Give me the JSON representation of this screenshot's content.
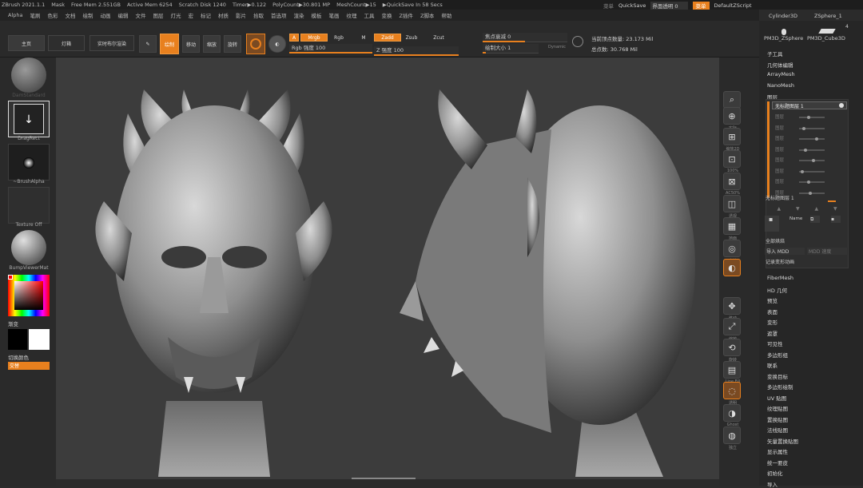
{
  "titlebar": {
    "app": "ZBrush 2021.1.1",
    "mask": "Mask",
    "free_mem": "Free Mem 2.551GB",
    "active_mem": "Active Mem 6254",
    "scratch_disk": "Scratch Disk 1240",
    "timer": "Timer▶0.122",
    "poly_count": "PolyCount▶30.801 MP",
    "mesh_count": "MeshCount▶15",
    "quicksave": "▶QuickSave In 58 Secs"
  },
  "topright": {
    "menu": "菜单",
    "quicksave_btn": "QuickSave",
    "transparency": "界面透明 0",
    "accent": "菜单",
    "script": "DefaultZScript"
  },
  "menubar": [
    "Alpha",
    "笔刷",
    "色彩",
    "文档",
    "绘制",
    "动画",
    "编辑",
    "文件",
    "图层",
    "灯光",
    "宏",
    "标记",
    "材质",
    "影片",
    "拾取",
    "首选项",
    "渲染",
    "模板",
    "笔画",
    "纹理",
    "工具",
    "变换",
    "Z插件",
    "Z脚本",
    "帮助"
  ],
  "toolbar": {
    "home": "主页",
    "lightbox": "灯箱",
    "live_boolean": "实时布尔渲染",
    "edit": "编辑",
    "draw": "绘制",
    "move": "移动",
    "scale": "缩放",
    "rotate": "旋转",
    "a": "A",
    "mrgb": "Mrgb",
    "rgb": "Rgb",
    "m": "M",
    "zadd": "Zadd",
    "zsub": "Zsub",
    "zcut": "Zcut",
    "rgb_intensity": "Rgb 强度 100",
    "z_intensity": "Z 强度 100",
    "focal_shift": "焦点衰减 0",
    "draw_size": "绘制大小 1",
    "dynamic": "Dynamic",
    "active_points": "当前顶点数量: 23.173 Mil",
    "total_points": "总点数: 30.768 Mil"
  },
  "leftshelf": {
    "brush": "DamStandard",
    "stroke": "DragRect",
    "alpha": "~BrushAlpha",
    "texture": "Texture Off",
    "material": "BumpViewerMat",
    "gradient": "渐变",
    "switch_color": "切换颜色",
    "alternate": "交替"
  },
  "rightshelf": [
    "缩放",
    "实际",
    "缩放2D",
    "100%",
    "AC50%",
    "透视",
    "地面",
    "本地",
    "",
    "移动",
    "缩放",
    "旋转",
    "Line Fill",
    "透明",
    "Ghost",
    "独立"
  ],
  "tray": {
    "thumbs": [
      "Cylinder3D",
      "ZSphere_1",
      "PM3D_ZSphere",
      "PM3D_Cube3D"
    ],
    "count": "4",
    "items_top": [
      "子工具",
      "几何体编辑",
      "ArrayMesh",
      "NanoMesh",
      "图层"
    ],
    "layer_name": "无标题图层 1",
    "layer_rows": [
      "图层",
      "图层",
      "图层",
      "图层",
      "图层",
      "图层",
      "图层",
      "图层"
    ],
    "layer_name2": "无标题图层 1",
    "name_btn": "Name",
    "bake_all": "全部烘焙",
    "import_mdd": "导入 MDD",
    "mdd_speed": "MDD 速度",
    "record_anim": "记录变形动画",
    "items_bottom": [
      "FiberMesh",
      "HD 几何",
      "预览",
      "表面",
      "变形",
      "遮罩",
      "可见性",
      "多边形组",
      "联系",
      "变换目标",
      "多边形绘制",
      "UV 贴图",
      "纹理贴图",
      "置换贴图",
      "法线贴图",
      "矢量置换贴图",
      "显示属性",
      "统一要皮",
      "初始化",
      "导入"
    ]
  },
  "colors": {
    "accent": "#e8801e",
    "bg": "#2b2b2b",
    "canvas": "#3c3c3c"
  }
}
